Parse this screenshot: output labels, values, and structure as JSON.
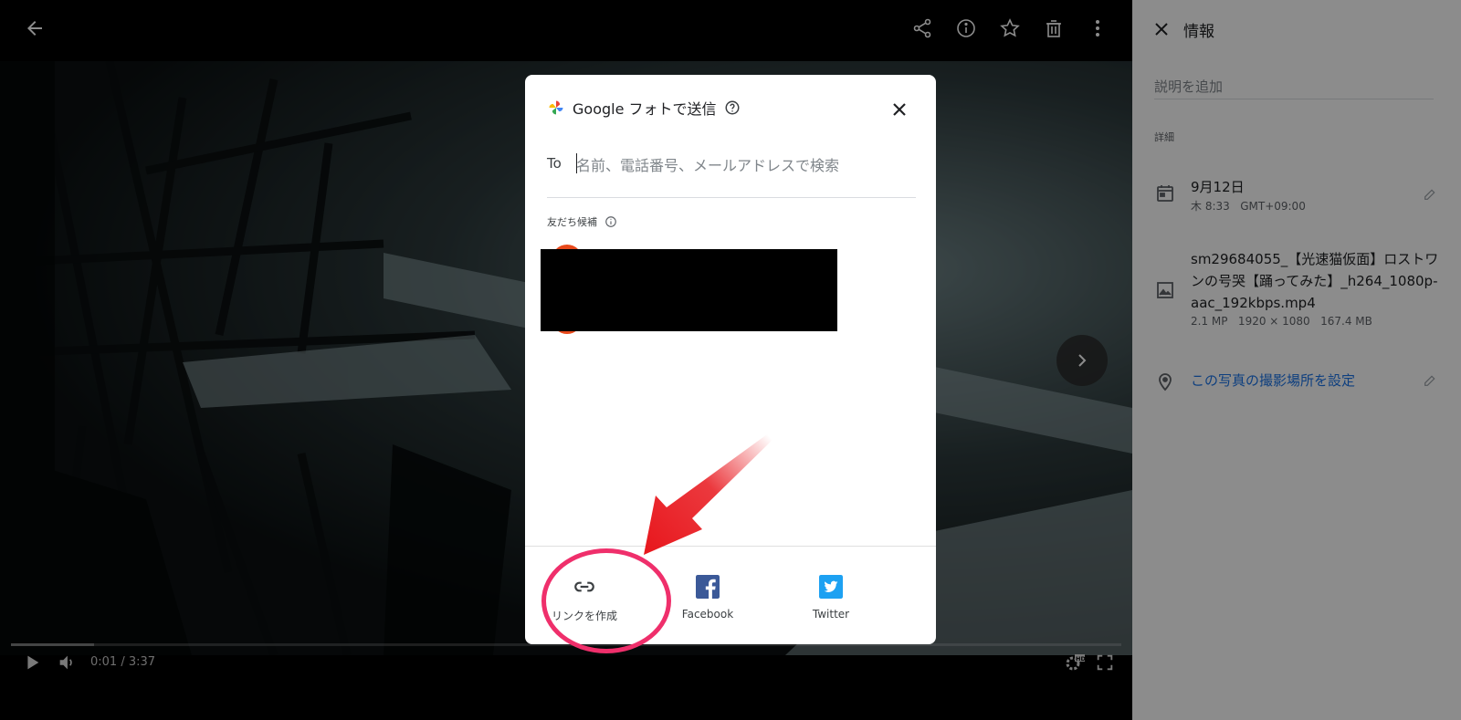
{
  "viewer": {
    "back_label": "back",
    "video": {
      "timecode": "0:01 / 3:37",
      "progress_fraction": 0.075
    }
  },
  "info_panel": {
    "title": "情報",
    "description_placeholder": "説明を追加",
    "section_label": "詳細",
    "date": {
      "primary": "9月12日",
      "secondary": "木 8:33   GMT+09:00"
    },
    "file": {
      "name": "sm29684055_【光速猫仮面】ロストワンの号哭【踊ってみた】_h264_1080p-aac_192kbps.mp4",
      "meta": "2.1 MP   1920 × 1080   167.4 MB"
    },
    "location_link": "この写真の撮影場所を設定"
  },
  "share_dialog": {
    "title": "Google フォトで送信",
    "to_label": "To",
    "search_placeholder": "名前、電話番号、メールアドレスで検索",
    "suggestions_label": "友だち候補",
    "actions": [
      {
        "label": "リンクを作成",
        "icon": "link-icon"
      },
      {
        "label": "Facebook",
        "icon": "facebook-icon",
        "color": "#3b5998"
      },
      {
        "label": "Twitter",
        "icon": "twitter-icon",
        "color": "#1da1f2"
      }
    ]
  },
  "annotation": {
    "arrow_color": "#e8161c",
    "circle_color": "#ef2f6b"
  }
}
